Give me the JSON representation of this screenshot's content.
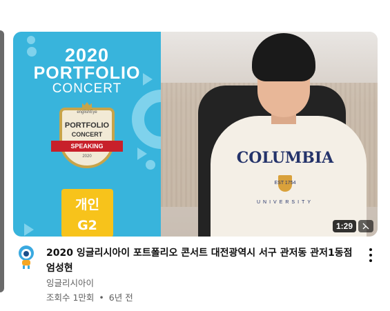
{
  "thumbnail": {
    "event": {
      "year": "2020",
      "title": "PORTFOLIO",
      "subtitle": "CONCERT"
    },
    "badge": {
      "brand": "englishEye",
      "line1": "PORTFOLIO",
      "line2": "CONCERT",
      "ribbon": "SPEAKING",
      "year": "2020"
    },
    "level": {
      "type": "개인",
      "grade": "G2"
    },
    "shirt": {
      "logo": "COLUMBIA",
      "est": "EST   1754",
      "university": "UNIVERSITY"
    },
    "duration": "1:29",
    "colors": {
      "panel": "#38b4dc",
      "accent_shape": "#7fd2ec",
      "level_box": "#f7c31b"
    }
  },
  "video": {
    "title": "2020 잉글리시아이 포트폴리오 콘서트 대전광역시 서구 관저동 관저1동점 엄성현",
    "channel": "잉글리시아이",
    "views": "조회수 1만회",
    "separator": "•",
    "age": "6년 전"
  },
  "icons": {
    "avatar": "channel-mascot-avatar",
    "menu": "more-vert-icon",
    "miniplayer": "miniplayer-icon"
  }
}
